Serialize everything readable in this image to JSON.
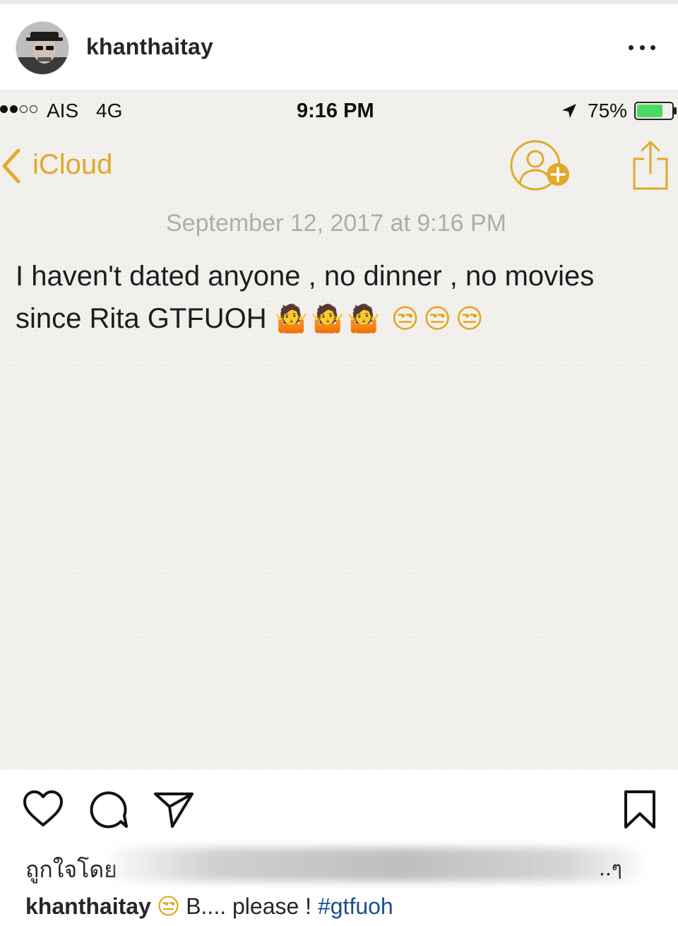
{
  "post": {
    "username": "khanthaitay"
  },
  "note_screenshot": {
    "status_bar": {
      "carrier": "AIS",
      "network": "4G",
      "time": "9:16 PM",
      "battery_percent": "75%",
      "signal_bars_filled": 2,
      "signal_bars_total": 5,
      "battery_level": 0.75
    },
    "nav": {
      "back_label": "iCloud"
    },
    "date": "September 12, 2017 at 9:16 PM",
    "body_line1": "I haven't dated anyone , no dinner , no movies",
    "body_line2": "since Rita GTFUOH",
    "emoji_shrug": "🤷🤷🤷",
    "emoji_unamused": "😒😒😒"
  },
  "likes": {
    "prefix": "ถูกใจโดย",
    "tail": "..ๆ"
  },
  "caption": {
    "username": "khanthaitay",
    "emoji": "😒",
    "text": "B.... please !",
    "hashtag": "#gtfuoh"
  },
  "colors": {
    "notes_accent": "#e2a92a",
    "hashtag": "#1a4f8f",
    "battery_fill": "#4cd964"
  },
  "icons": {
    "more": "more-dots-icon",
    "heart": "heart-icon",
    "comment": "comment-icon",
    "share": "send-icon",
    "save": "bookmark-icon",
    "add_person": "add-person-icon",
    "share_note": "share-icon",
    "location": "location-arrow-icon"
  }
}
